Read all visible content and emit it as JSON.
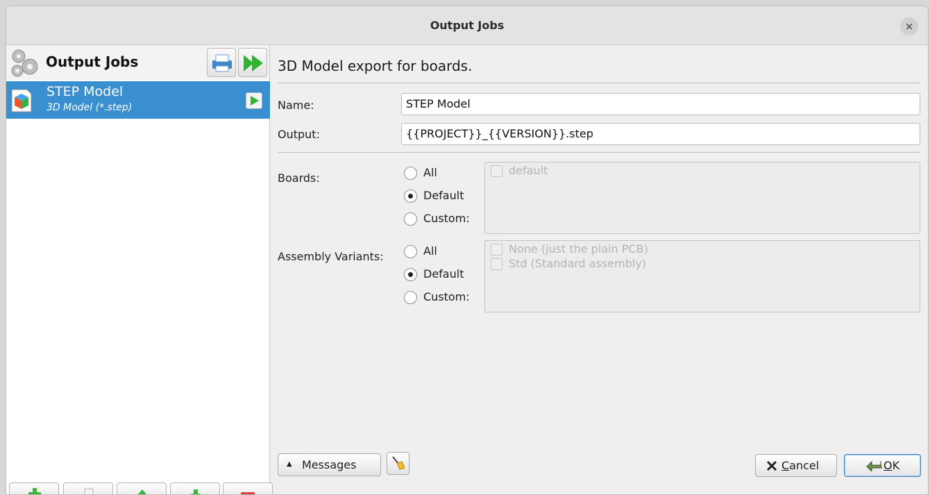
{
  "window": {
    "title": "Output Jobs",
    "close_glyph": "×"
  },
  "left": {
    "header_title": "Output Jobs",
    "header_icon": "gears-icon",
    "buttons": {
      "print": "printer-icon",
      "run_all": "run-all-icon"
    },
    "jobs": [
      {
        "name": "STEP Model",
        "type": "3D Model (*.step)",
        "icon": "3d-model-icon",
        "selected": true
      }
    ],
    "bottom_buttons": [
      "add-icon",
      "copy-icon",
      "move-up-icon",
      "move-down-icon",
      "remove-icon"
    ]
  },
  "right": {
    "description": "3D Model export for boards.",
    "name": {
      "label": "Name:",
      "value": "STEP Model"
    },
    "output": {
      "label": "Output:",
      "value": "{{PROJECT}}_{{VERSION}}.step"
    },
    "boards": {
      "label": "Boards:",
      "options": [
        "All",
        "Default",
        "Custom:"
      ],
      "selected": "Default",
      "items": [
        "default"
      ]
    },
    "variants": {
      "label": "Assembly Variants:",
      "options": [
        "All",
        "Default",
        "Custom:"
      ],
      "selected": "Default",
      "items": [
        "None (just the plain PCB)",
        "Std (Standard assembly)"
      ]
    },
    "messages_button": "Messages",
    "messages_arrow": "▲",
    "clear_icon": "broom-icon",
    "cancel": {
      "prefix": "",
      "mnemonic": "C",
      "rest": "ancel"
    },
    "ok": {
      "mnemonic": "O",
      "rest": "K"
    }
  },
  "colors": {
    "selection": "#3a8fd0",
    "accent_green": "#2fb52f",
    "remove_red": "#e03b3b"
  }
}
